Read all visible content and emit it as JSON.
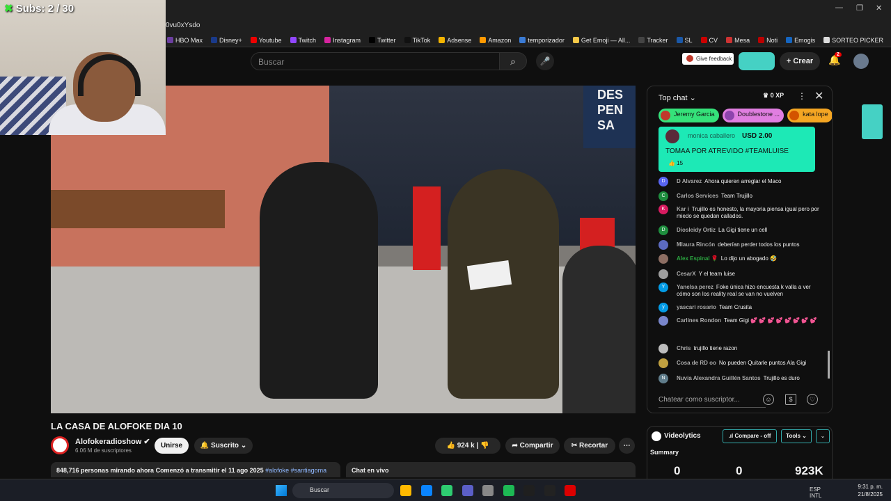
{
  "browser": {
    "url": "0vu0xYsdo",
    "window_controls": [
      "—",
      "❐",
      "✕"
    ],
    "bookmarks": [
      "HBO Max",
      "Disney+",
      "Youtube",
      "Twitch",
      "Instagram",
      "Twitter",
      "TikTok",
      "Adsense",
      "Amazon",
      "temporizador",
      "Get Emoji — All...",
      "Tracker",
      "SL",
      "CV",
      "Mesa",
      "Noti",
      "Emogis",
      "SORTEO PICKER"
    ],
    "bookmark_colors": [
      "#6b3fa0",
      "#1a3a8a",
      "#e00",
      "#9146ff",
      "#d6249f",
      "#000",
      "#111",
      "#f4b400",
      "#ff9900",
      "#3a7bd5",
      "#f7c948",
      "#444",
      "#1a58a8",
      "#c00",
      "#c33",
      "#b00",
      "#1565c0",
      "#ddd"
    ]
  },
  "overlay": {
    "subs_icon": "✖",
    "subs_text": "Subs: 2 / 30"
  },
  "header": {
    "search_placeholder": "Buscar",
    "search_icon": "⌕",
    "mic_icon": "🎤",
    "feedback_label": "Give feedback",
    "create_label": "+ Crear",
    "bell_icon": "🔔",
    "notification_count": "2"
  },
  "video": {
    "sign_text": "DES PEN SA",
    "title": "LA CASA DE ALOFOKE DIA 10"
  },
  "channel": {
    "name": "Alofokeradioshow ✔",
    "subscribers": "6.06 M de suscriptores",
    "join_label": "Unirse",
    "subscribed_label": "🔔 Suscrito ⌄"
  },
  "actions": {
    "like_label": "👍  924 k  |  👎",
    "share_label": "➦ Compartir",
    "clip_label": "✂ Recortar",
    "more_label": "⋯"
  },
  "description": {
    "text": "848,716 personas mirando ahora  Comenzó a transmitir el 11 ago 2025 ",
    "tags": "#alofoke #santiagoma"
  },
  "live_chat_tab": "Chat en vivo",
  "chat": {
    "header": "Top chat ⌄",
    "xp": "♛ 0 XP",
    "menu_icon": "⋮",
    "close_icon": "✕",
    "donors": [
      {
        "name": "Jeremy Garcia",
        "color": "#35e27a",
        "avatar": "#c0392b"
      },
      {
        "name": "Doublestone ...",
        "color": "#e07ee0",
        "avatar": "#8e44ad"
      },
      {
        "name": "kata lope",
        "color": "#f5a623",
        "avatar": "#d35400"
      }
    ],
    "superchat": {
      "name": "monica caballero",
      "amount": "USD 2.00",
      "message": "TOMAA POR ATREVIDO #TEAMLUISE",
      "likes": "👍 15"
    },
    "messages": [
      {
        "initial": "D",
        "avatar": "#5865f2",
        "name": "D Alvarez",
        "text": "Ahora quieren arreglar el Maco",
        "green": false
      },
      {
        "initial": "C",
        "avatar": "#1e8e3e",
        "name": "Carlos Services",
        "text": "Team Trujillo",
        "green": false
      },
      {
        "initial": "K",
        "avatar": "#d81b60",
        "name": "Kar i",
        "text": "Trujillo es honesto, la mayoria piensa igual pero por miedo se quedan callados.",
        "green": false
      },
      {
        "initial": "D",
        "avatar": "#1e8e3e",
        "name": "Diosleidy Ortiz",
        "text": "La Gigi tiene un cell",
        "green": false
      },
      {
        "initial": "",
        "avatar": "#5c6bc0",
        "name": "Mlaura Rincón",
        "text": "deberían perder todos los puntos",
        "green": false
      },
      {
        "initial": "",
        "avatar": "#8d6e63",
        "name": "Alex Espinal 🌹",
        "text": "Lo dijo un abogado 🤣",
        "green": true
      },
      {
        "initial": "",
        "avatar": "#9e9e9e",
        "name": "CesarX",
        "text": "Y el team luise",
        "green": false
      },
      {
        "initial": "Y",
        "avatar": "#039be5",
        "name": "Yanelsa perez",
        "text": "Foke única hizo encuesta k valla a ver cómo son los reality real se van no vuelven",
        "green": false
      },
      {
        "initial": "y",
        "avatar": "#039be5",
        "name": "yascari rosario",
        "text": "Team Crusita",
        "green": false
      },
      {
        "initial": "",
        "avatar": "#7986cb",
        "name": "Carlines Rondon",
        "text": "Team Gigi 💕 💕 💕 💕 💕 💕 💕 💕",
        "green": false
      },
      {
        "initial": "",
        "avatar": "#bdbdbd",
        "name": "Chris",
        "text": "trujillo tiene razon",
        "green": false
      },
      {
        "initial": "",
        "avatar": "#c0a040",
        "name": "Cosa de RD oo",
        "text": "No pueden Quitarle puntos Ala Gigi",
        "green": false
      },
      {
        "initial": "N",
        "avatar": "#607d8b",
        "name": "Nuvia Alexandra Guillén Santos",
        "text": "Trujillo es duro",
        "green": false
      }
    ],
    "input_placeholder": "Chatear como suscriptor...",
    "emoji_icon": "☺",
    "dollar_icon": "$",
    "heart_icon": "♡"
  },
  "videolytics": {
    "name": "Videolytics",
    "compare_label": ".ıl Compare - off",
    "tools_label": "Tools ⌄",
    "dropdown_icon": "⌄",
    "summary_label": "Summary",
    "values": [
      "0",
      "0",
      "923K"
    ]
  },
  "taskbar": {
    "search_label": "Buscar",
    "tray_lang": "ESP INTL",
    "time": "9:31 p. m.",
    "date": "21/8/2025",
    "apps": [
      "#ffb900",
      "#0a84ff",
      "#2ecc71",
      "#5b5fc7",
      "#888",
      "#1db954",
      "#1f1f1f",
      "#222",
      "#d00"
    ]
  }
}
